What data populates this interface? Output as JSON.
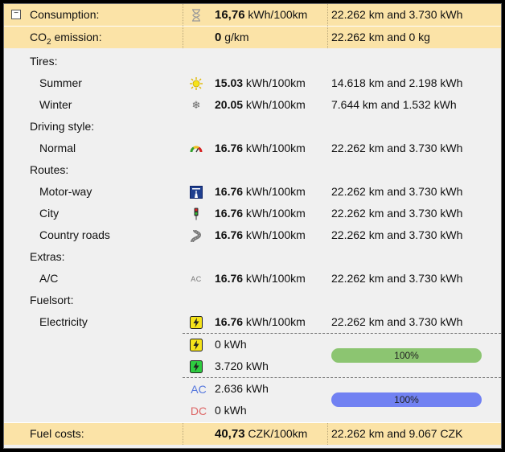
{
  "consumption": {
    "label": "Consumption:",
    "icon": "hourglass-icon",
    "value": "16,76",
    "unit": " kWh/100km",
    "detail": "22.262 km and 3.730 kWh"
  },
  "co2": {
    "label_prefix": "CO",
    "label_sub": "2",
    "label_suffix": " emission:",
    "value": "0",
    "unit": " g/km",
    "detail": "22.262 km and 0 kg"
  },
  "tires": {
    "header": "Tires:",
    "summer": {
      "label": "Summer",
      "icon": "sun-icon",
      "value": "15.03",
      "unit": " kWh/100km",
      "detail": "14.618 km and 2.198 kWh"
    },
    "winter": {
      "label": "Winter",
      "icon": "snowflake-icon",
      "value": "20.05",
      "unit": " kWh/100km",
      "detail": "7.644 km and 1.532 kWh"
    }
  },
  "driving_style": {
    "header": "Driving style:",
    "normal": {
      "label": "Normal",
      "icon": "gauge-icon",
      "value": "16.76",
      "unit": " kWh/100km",
      "detail": "22.262 km and 3.730 kWh"
    }
  },
  "routes": {
    "header": "Routes:",
    "motorway": {
      "label": "Motor-way",
      "icon": "motorway-icon",
      "value": "16.76",
      "unit": " kWh/100km",
      "detail": "22.262 km and 3.730 kWh"
    },
    "city": {
      "label": "City",
      "icon": "traffic-light-icon",
      "value": "16.76",
      "unit": " kWh/100km",
      "detail": "22.262 km and 3.730 kWh"
    },
    "country": {
      "label": "Country roads",
      "icon": "winding-road-icon",
      "value": "16.76",
      "unit": " kWh/100km",
      "detail": "22.262 km and 3.730 kWh"
    }
  },
  "extras": {
    "header": "Extras:",
    "ac": {
      "label": "A/C",
      "icon_text": "AC",
      "value": "16.76",
      "unit": " kWh/100km",
      "detail": "22.262 km and 3.730 kWh"
    }
  },
  "fuelsort": {
    "header": "Fuelsort:",
    "electricity": {
      "label": "Electricity",
      "icon": "charging-yellow-icon",
      "value": "16.76",
      "unit": " kWh/100km",
      "detail": "22.262 km and 3.730 kWh"
    },
    "charge_yellow": {
      "icon": "charging-yellow-icon",
      "value": "0 kWh"
    },
    "charge_green": {
      "icon": "charging-green-icon",
      "value": "3.720 kWh"
    },
    "charge_bar": {
      "label": "100%",
      "fraction": 1.0,
      "color": "#8cc571"
    },
    "ac_charge": {
      "tag": "AC",
      "value": "2.636 kWh"
    },
    "dc_charge": {
      "tag": "DC",
      "value": "0 kWh"
    },
    "current_bar": {
      "label": "100%",
      "fraction": 1.0,
      "color": "#7181f2"
    }
  },
  "fuel_costs": {
    "label": "Fuel costs:",
    "value": "40,73",
    "unit": " CZK/100km",
    "detail": "22.262 km and 9.067 CZK"
  },
  "colors": {
    "highlight": "#fbe3a7",
    "ac_tag": "#5577dd",
    "dc_tag": "#dd6666"
  }
}
